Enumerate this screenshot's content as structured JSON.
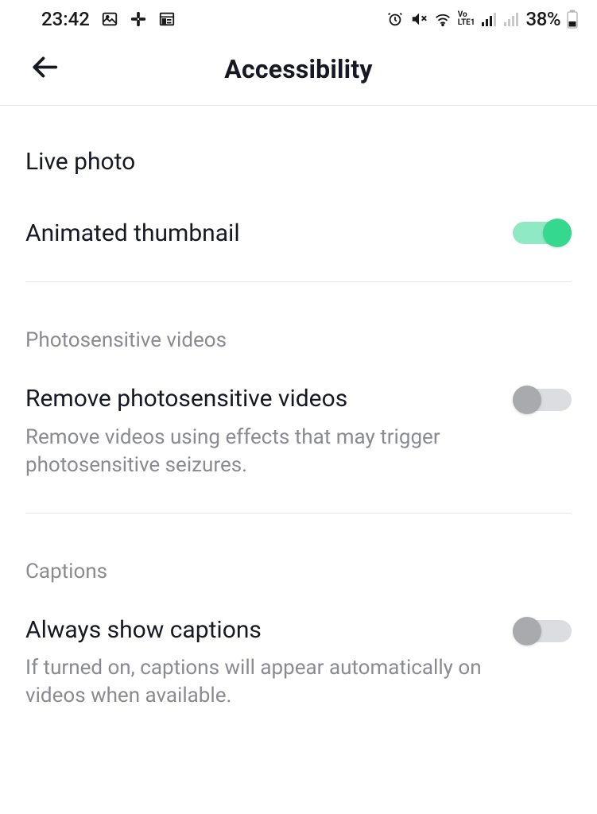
{
  "status": {
    "time": "23:42",
    "battery": "38%"
  },
  "header": {
    "title": "Accessibility"
  },
  "settings": {
    "live_photo": {
      "label": "Live photo"
    },
    "animated_thumbnail": {
      "label": "Animated thumbnail",
      "on": true
    },
    "section_photosensitive": {
      "header": "Photosensitive videos"
    },
    "remove_photosensitive": {
      "label": "Remove photosensitive videos",
      "desc": "Remove videos using effects that may trigger photosensitive seizures.",
      "on": false
    },
    "section_captions": {
      "header": "Captions"
    },
    "always_show_captions": {
      "label": "Always show captions",
      "desc": "If turned on, captions will appear automatically on videos when available.",
      "on": false
    }
  }
}
